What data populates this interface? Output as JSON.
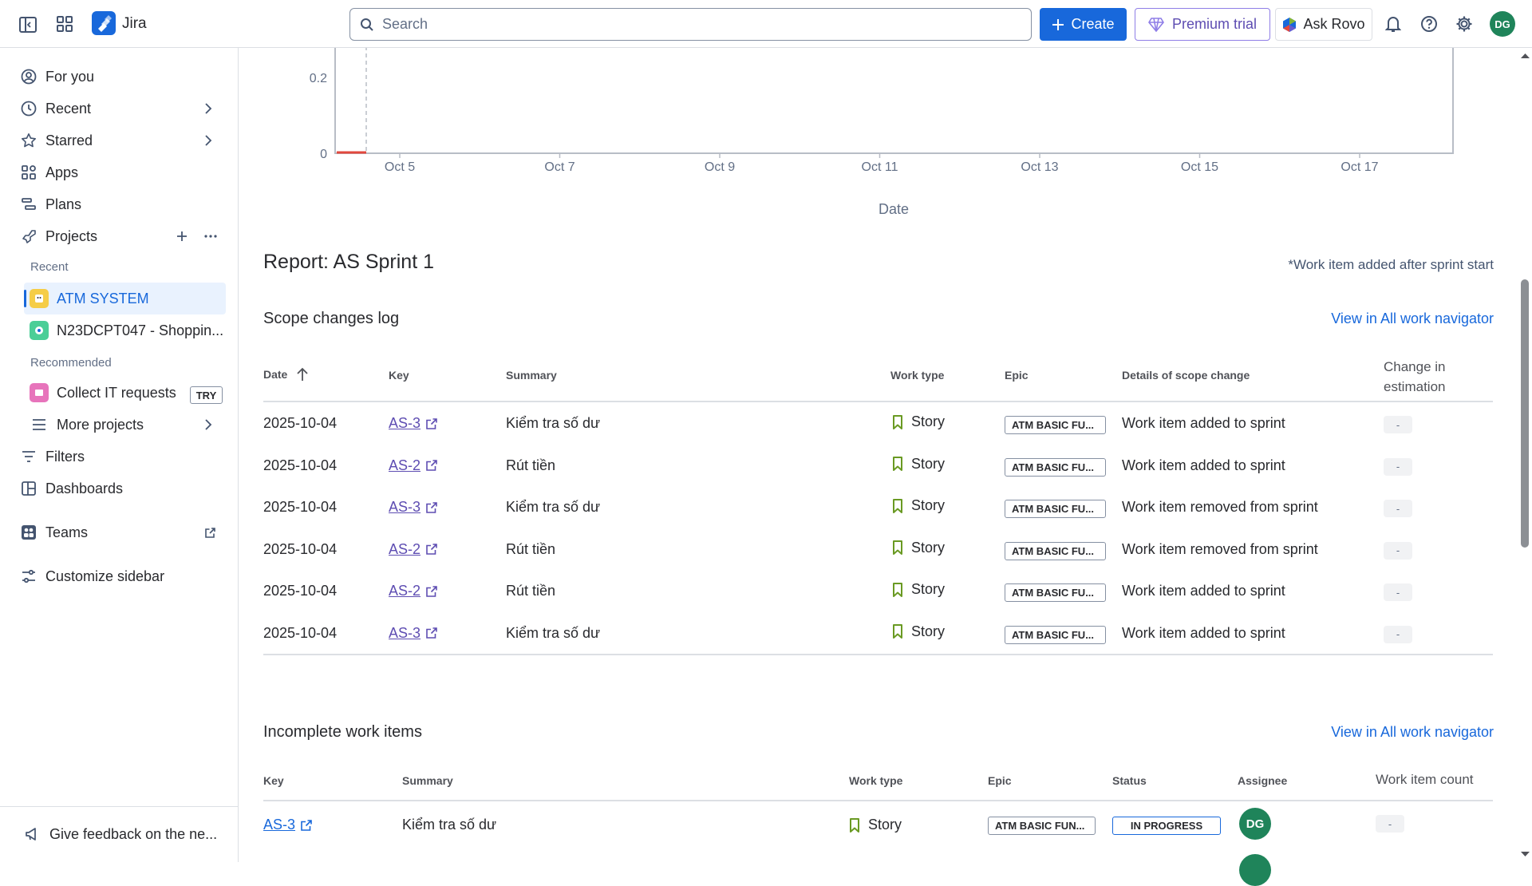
{
  "topbar": {
    "brand": "Jira",
    "search_placeholder": "Search",
    "create_label": "Create",
    "premium_label": "Premium trial",
    "rovo_label": "Ask Rovo",
    "user_initials": "DG"
  },
  "sidebar": {
    "for_you": "For you",
    "recent": "Recent",
    "starred": "Starred",
    "apps": "Apps",
    "plans": "Plans",
    "projects": "Projects",
    "recent_header": "Recent",
    "project_1": "ATM SYSTEM",
    "project_2": "N23DCPT047 - Shoppin...",
    "recommended_header": "Recommended",
    "collect": "Collect IT requests",
    "try_badge": "TRY",
    "more_projects": "More projects",
    "filters": "Filters",
    "dashboards": "Dashboards",
    "teams": "Teams",
    "customize": "Customize sidebar",
    "feedback": "Give feedback on the ne..."
  },
  "chart_data": {
    "type": "line",
    "xlabel": "Date",
    "x_ticks": [
      "Oct 5",
      "Oct 7",
      "Oct 9",
      "Oct 11",
      "Oct 13",
      "Oct 15",
      "Oct 17"
    ],
    "y_ticks": [
      "0.2",
      "0"
    ],
    "series": [
      {
        "color": "#e2483d",
        "x": [
          "Oct 4",
          "Oct 4"
        ],
        "values": [
          0,
          0
        ]
      }
    ]
  },
  "report": {
    "title": "Report: AS Sprint 1",
    "note": "*Work item added after sprint start"
  },
  "scope_log": {
    "title": "Scope changes log",
    "view_link": "View in All work navigator",
    "headers": {
      "date": "Date",
      "key": "Key",
      "summary": "Summary",
      "work_type": "Work type",
      "epic": "Epic",
      "details": "Details of scope change",
      "change_1": "Change in",
      "change_2": "estimation"
    },
    "rows": [
      {
        "date": "2025-10-04",
        "key": "AS-3",
        "summary": "Kiểm tra số dư",
        "type": "Story",
        "epic": "ATM BASIC FU...",
        "details": "Work item added to sprint",
        "change": "-"
      },
      {
        "date": "2025-10-04",
        "key": "AS-2",
        "summary": "Rút tiền",
        "type": "Story",
        "epic": "ATM BASIC FU...",
        "details": "Work item added to sprint",
        "change": "-"
      },
      {
        "date": "2025-10-04",
        "key": "AS-3",
        "summary": "Kiểm tra số dư",
        "type": "Story",
        "epic": "ATM BASIC FU...",
        "details": "Work item removed from sprint",
        "change": "-"
      },
      {
        "date": "2025-10-04",
        "key": "AS-2",
        "summary": "Rút tiền",
        "type": "Story",
        "epic": "ATM BASIC FU...",
        "details": "Work item removed from sprint",
        "change": "-"
      },
      {
        "date": "2025-10-04",
        "key": "AS-2",
        "summary": "Rút tiền",
        "type": "Story",
        "epic": "ATM BASIC FU...",
        "details": "Work item added to sprint",
        "change": "-"
      },
      {
        "date": "2025-10-04",
        "key": "AS-3",
        "summary": "Kiểm tra số dư",
        "type": "Story",
        "epic": "ATM BASIC FU...",
        "details": "Work item added to sprint",
        "change": "-"
      }
    ]
  },
  "incomplete": {
    "title": "Incomplete work items",
    "view_link": "View in All work navigator",
    "headers": {
      "key": "Key",
      "summary": "Summary",
      "work_type": "Work type",
      "epic": "Epic",
      "status": "Status",
      "assignee": "Assignee",
      "count": "Work item count"
    },
    "rows": [
      {
        "key": "AS-3",
        "summary": "Kiểm tra số dư",
        "type": "Story",
        "epic": "ATM BASIC FUN...",
        "status": "IN PROGRESS",
        "assignee": "DG",
        "count": "-"
      }
    ]
  },
  "colors": {
    "accent": "#1868db",
    "link": "#5e4db2",
    "story": "#6a9a23",
    "assignee": "#1f845a"
  }
}
